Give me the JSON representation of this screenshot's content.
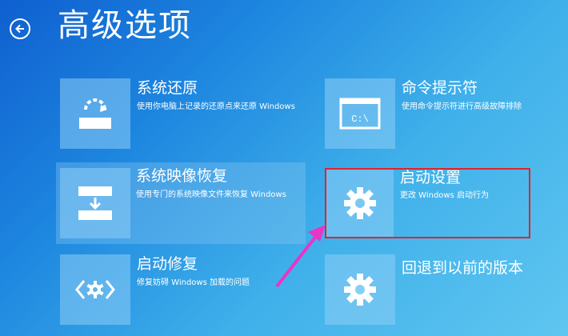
{
  "header": {
    "title": "高级选项",
    "back_icon": "back-arrow-icon"
  },
  "options": [
    {
      "title": "系统还原",
      "description": "使用你电脑上记录的还原点来还原 Windows",
      "icon": "restore-icon"
    },
    {
      "title": "命令提示符",
      "description": "使用命令提示符进行高级故障排除",
      "icon": "command-prompt-icon"
    },
    {
      "title": "系统映像恢复",
      "description": "使用专门的系统映像文件来恢复 Windows",
      "icon": "image-recovery-icon"
    },
    {
      "title": "启动设置",
      "description": "更改 Windows 启动行为",
      "icon": "gear-icon"
    },
    {
      "title": "启动修复",
      "description": "修复妨碍 Windows 加载的问题",
      "icon": "startup-repair-icon"
    },
    {
      "title": "回退到以前的版本",
      "description": "",
      "icon": "gear-icon"
    }
  ],
  "annotation": {
    "box_color": "#e0242b",
    "arrow_color": "#ea34c7"
  },
  "cmd_glyph": "C:\\"
}
